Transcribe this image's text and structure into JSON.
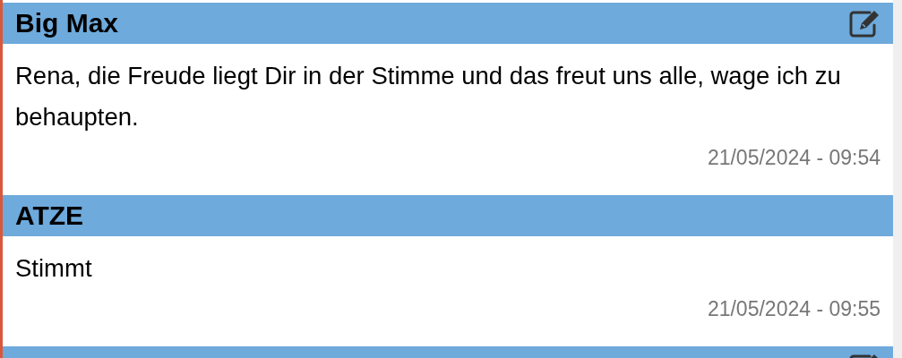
{
  "posts": [
    {
      "author": "Big Max",
      "editable": true,
      "text": "Rena, die Freude liegt Dir in der Stimme und das freut uns alle, wage ich zu behaupten.",
      "time": "21/05/2024 - 09:54"
    },
    {
      "author": "ATZE",
      "editable": false,
      "text": "Stimmt",
      "time": "21/05/2024 - 09:55"
    },
    {
      "editable": true
    }
  ]
}
